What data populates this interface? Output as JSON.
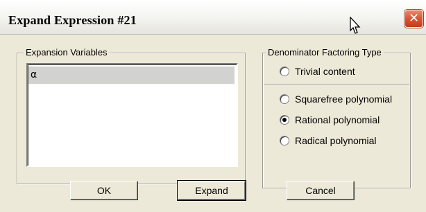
{
  "window": {
    "title": "Expand Expression #21",
    "close_glyph": "✕"
  },
  "expansion_variables": {
    "label": "Expansion Variables",
    "items": [
      "α"
    ]
  },
  "denominator": {
    "label": "Denominator Factoring Type",
    "options": [
      {
        "label": "Trivial content",
        "checked": false
      },
      {
        "label": "Squarefree polynomial",
        "checked": false
      },
      {
        "label": "Rational polynomial",
        "checked": true
      },
      {
        "label": "Radical polynomial",
        "checked": false
      }
    ]
  },
  "buttons": {
    "ok": "OK",
    "expand": "Expand",
    "cancel": "Cancel"
  },
  "icons": {
    "close": "close-icon",
    "cursor": "mouse-pointer-icon"
  }
}
